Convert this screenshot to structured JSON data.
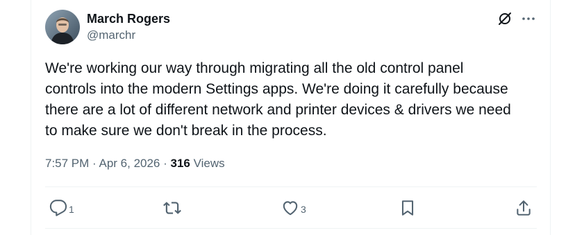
{
  "author": {
    "display_name": "March Rogers",
    "handle": "@marchr",
    "avatar_icon": "user-avatar"
  },
  "header_icons": [
    "grok-icon",
    "more-icon"
  ],
  "tweet": {
    "text": "We're working our way through migrating all the old control panel\ncontrols into the modern Settings apps. We're doing it carefully because\nthere are a lot of different network and printer devices & drivers we need\nto make sure we don't break in the process."
  },
  "meta": {
    "time": "7:57 PM",
    "separator_1": " · ",
    "date": "Apr 6, 2026",
    "separator_2": " · ",
    "views_count": "316",
    "views_label": " Views"
  },
  "actions": {
    "reply": {
      "icon": "reply-icon",
      "count": "1"
    },
    "repost": {
      "icon": "repost-icon",
      "count": ""
    },
    "like": {
      "icon": "heart-icon",
      "count": "3"
    },
    "bookmark": {
      "icon": "bookmark-icon",
      "count": ""
    },
    "share": {
      "icon": "share-icon",
      "count": ""
    }
  },
  "colors": {
    "text_primary": "#0f1419",
    "text_secondary": "#536471",
    "divider": "#eff3f4"
  }
}
